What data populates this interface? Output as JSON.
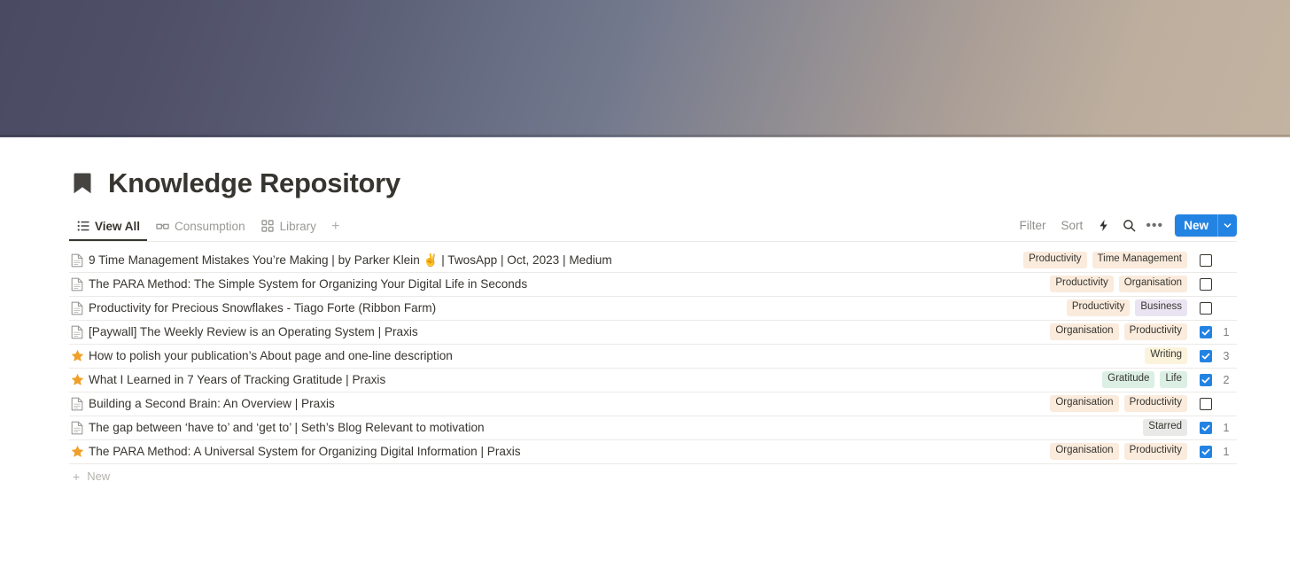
{
  "cover": {
    "gradient_from": "#4a4a62",
    "gradient_mid": "#73798d",
    "gradient_to": "#c3b3a1"
  },
  "header": {
    "icon": "bookmark-icon",
    "title": "Knowledge Repository"
  },
  "tabs": [
    {
      "label": "View All",
      "icon": "list-icon",
      "active": true
    },
    {
      "label": "Consumption",
      "icon": "glasses-icon",
      "active": false
    },
    {
      "label": "Library",
      "icon": "grid-icon",
      "active": false
    }
  ],
  "tab_add_label": "+",
  "toolbar": {
    "filter_label": "Filter",
    "sort_label": "Sort",
    "automation_icon": "lightning-bolt-icon",
    "search_icon": "search-icon",
    "more_icon": "ellipsis-icon",
    "new_label": "New",
    "new_caret_icon": "chevron-down-icon",
    "accent_color": "#2383e2"
  },
  "rows": [
    {
      "icon": "document-icon",
      "title": "9 Time Management Mistakes You’re Making | by Parker Klein ✌️ | TwosApp | Oct, 2023 | Medium",
      "tags": [
        {
          "label": "Productivity",
          "color": "orange"
        },
        {
          "label": "Time Management",
          "color": "orange"
        }
      ],
      "checked": false,
      "count": ""
    },
    {
      "icon": "document-icon",
      "title": "The PARA Method: The Simple System for Organizing Your Digital Life in Seconds",
      "tags": [
        {
          "label": "Productivity",
          "color": "orange"
        },
        {
          "label": "Organisation",
          "color": "orange"
        }
      ],
      "checked": false,
      "count": ""
    },
    {
      "icon": "document-icon",
      "title": "Productivity for Precious Snowflakes - Tiago Forte (Ribbon Farm)",
      "tags": [
        {
          "label": "Productivity",
          "color": "orange"
        },
        {
          "label": "Business",
          "color": "purple"
        }
      ],
      "checked": false,
      "count": ""
    },
    {
      "icon": "document-icon",
      "title": "[Paywall] The Weekly Review is an Operating System | Praxis",
      "tags": [
        {
          "label": "Organisation",
          "color": "orange"
        },
        {
          "label": "Productivity",
          "color": "orange"
        }
      ],
      "checked": true,
      "count": "1"
    },
    {
      "icon": "star-icon",
      "title": "How to polish your publication’s About page and one-line description",
      "tags": [
        {
          "label": "Writing",
          "color": "yellow"
        }
      ],
      "checked": true,
      "count": "3"
    },
    {
      "icon": "star-icon",
      "title": "What I Learned in 7 Years of Tracking Gratitude | Praxis",
      "tags": [
        {
          "label": "Gratitude",
          "color": "green"
        },
        {
          "label": "Life",
          "color": "green"
        }
      ],
      "checked": true,
      "count": "2"
    },
    {
      "icon": "document-icon",
      "title": "Building a Second Brain: An Overview | Praxis",
      "tags": [
        {
          "label": "Organisation",
          "color": "orange"
        },
        {
          "label": "Productivity",
          "color": "orange"
        }
      ],
      "checked": false,
      "count": ""
    },
    {
      "icon": "document-icon",
      "title": "The gap between ‘have to’ and ‘get to’ | Seth’s Blog Relevant to motivation",
      "tags": [
        {
          "label": "Starred",
          "color": "gray"
        }
      ],
      "checked": true,
      "count": "1"
    },
    {
      "icon": "star-icon",
      "title": "The PARA Method: A Universal System for Organizing Digital Information | Praxis",
      "tags": [
        {
          "label": "Organisation",
          "color": "orange"
        },
        {
          "label": "Productivity",
          "color": "orange"
        }
      ],
      "checked": true,
      "count": "1"
    }
  ],
  "footer": {
    "new_row_label": "New"
  }
}
